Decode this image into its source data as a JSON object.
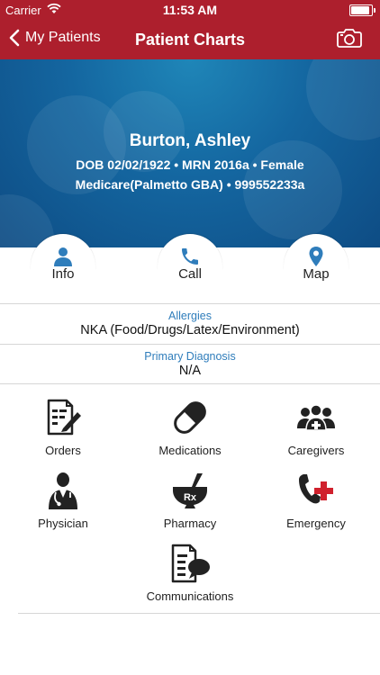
{
  "status_bar": {
    "carrier": "Carrier",
    "time": "11:53 AM",
    "battery_level": 1.0
  },
  "nav": {
    "back_label": "My Patients",
    "title": "Patient Charts",
    "camera_icon": "camera-icon"
  },
  "patient": {
    "name": "Burton, Ashley",
    "line1": "DOB 02/02/1922 • MRN 2016a • Female",
    "line2": "Medicare(Palmetto GBA) • 999552233a"
  },
  "actions": [
    {
      "label": "Info",
      "icon": "person-icon"
    },
    {
      "label": "Call",
      "icon": "phone-icon"
    },
    {
      "label": "Map",
      "icon": "map-pin-icon"
    }
  ],
  "allergies": {
    "label": "Allergies",
    "value": "NKA (Food/Drugs/Latex/Environment)"
  },
  "diagnosis": {
    "label": "Primary Diagnosis",
    "value": "N/A"
  },
  "grid": [
    {
      "label": "Orders",
      "icon": "orders-icon"
    },
    {
      "label": "Medications",
      "icon": "pill-icon"
    },
    {
      "label": "Caregivers",
      "icon": "caregivers-icon"
    },
    {
      "label": "Physician",
      "icon": "physician-icon"
    },
    {
      "label": "Pharmacy",
      "icon": "pharmacy-icon"
    },
    {
      "label": "Emergency",
      "icon": "emergency-icon"
    },
    {
      "label": "Communications",
      "icon": "communications-icon"
    }
  ],
  "colors": {
    "brand": "#ad1f2d",
    "accent": "#2f7dbb",
    "hero": "#1466a0",
    "emergency": "#d0212d"
  }
}
